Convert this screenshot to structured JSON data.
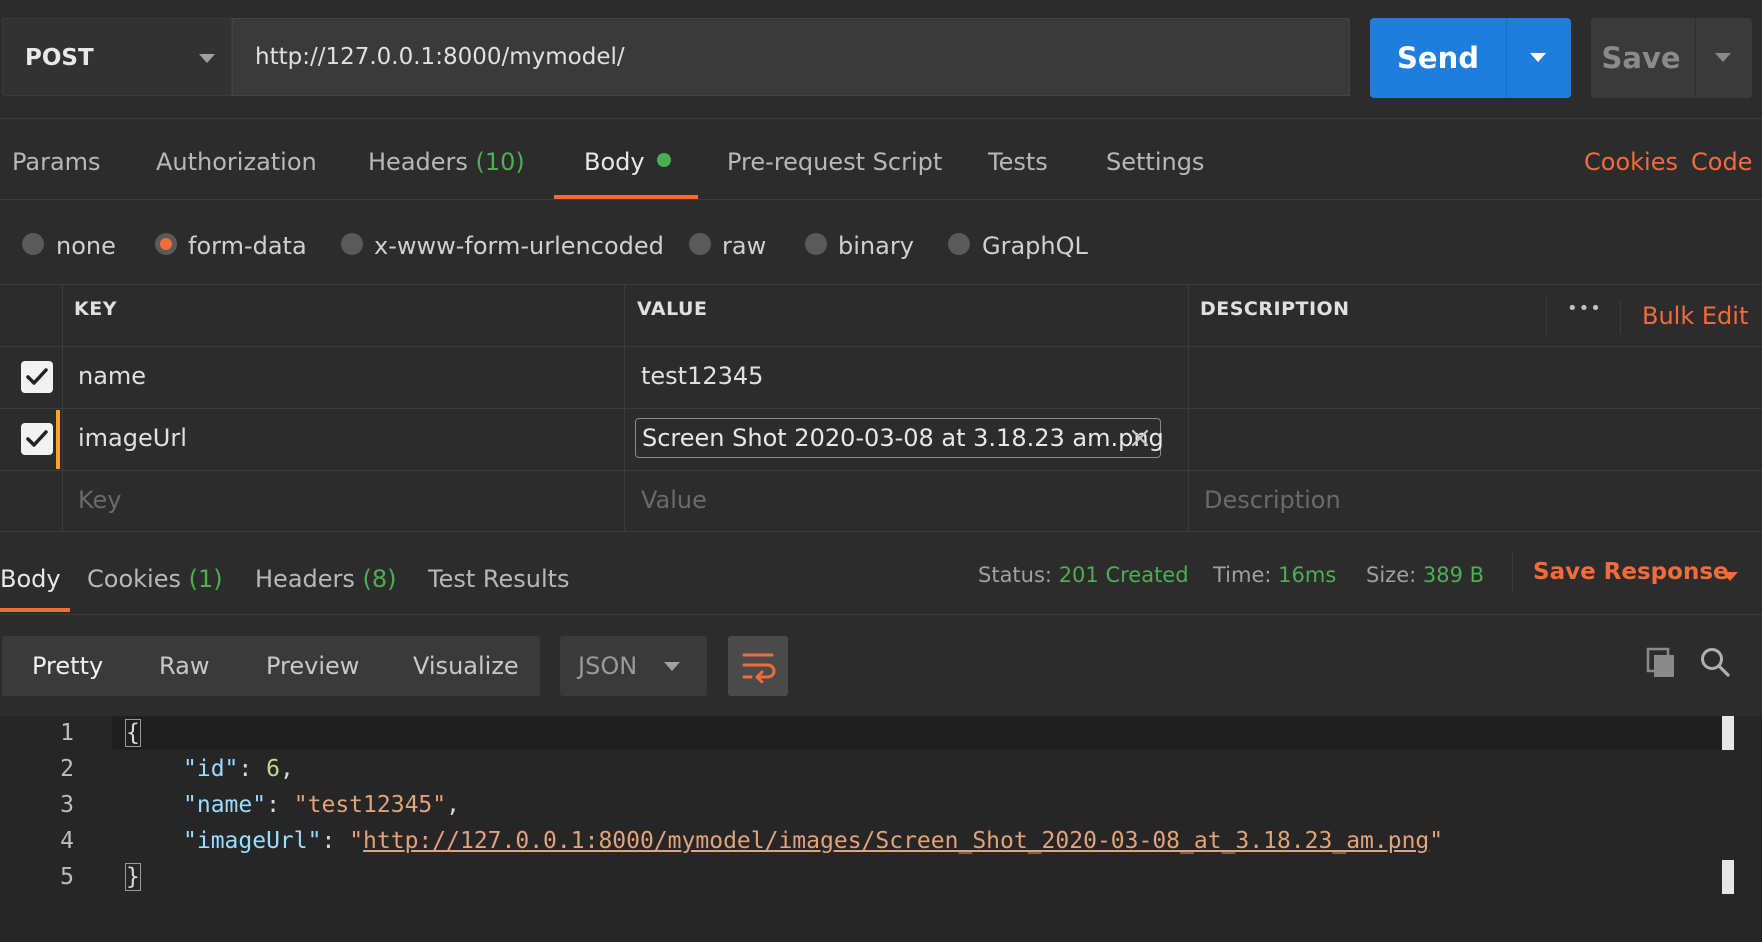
{
  "request": {
    "method": "POST",
    "url": "http://127.0.0.1:8000/mymodel/",
    "send_label": "Send",
    "save_label": "Save"
  },
  "request_tabs": {
    "params": "Params",
    "authorization": "Authorization",
    "headers": "Headers",
    "headers_count": "(10)",
    "body": "Body",
    "pre_request": "Pre-request Script",
    "tests": "Tests",
    "settings": "Settings",
    "cookies_link": "Cookies",
    "code_link": "Code"
  },
  "body_types": {
    "none": "none",
    "form_data": "form-data",
    "urlencoded": "x-www-form-urlencoded",
    "raw": "raw",
    "binary": "binary",
    "graphql": "GraphQL",
    "selected": "form-data"
  },
  "form_table": {
    "headers": {
      "key": "KEY",
      "value": "VALUE",
      "description": "DESCRIPTION"
    },
    "more_label": "•••",
    "bulk_edit": "Bulk Edit",
    "rows": [
      {
        "checked": true,
        "key": "name",
        "value": "test12345",
        "description": ""
      },
      {
        "checked": true,
        "key": "imageUrl",
        "value": "Screen Shot 2020-03-08 at 3.18.23 am.png",
        "description": ""
      }
    ],
    "placeholders": {
      "key": "Key",
      "value": "Value",
      "description": "Description"
    }
  },
  "response_tabs": {
    "body": "Body",
    "cookies": "Cookies",
    "cookies_count": "(1)",
    "headers": "Headers",
    "headers_count": "(8)",
    "test_results": "Test Results"
  },
  "response_status": {
    "status_label": "Status:",
    "status_value": "201 Created",
    "time_label": "Time:",
    "time_value": "16ms",
    "size_label": "Size:",
    "size_value": "389 B",
    "save_response": "Save Response"
  },
  "view_modes": {
    "pretty": "Pretty",
    "raw": "Raw",
    "preview": "Preview",
    "visualize": "Visualize",
    "format": "JSON"
  },
  "response_body": {
    "line_numbers": [
      "1",
      "2",
      "3",
      "4",
      "5"
    ],
    "open_brace": "{",
    "close_brace": "}",
    "id_key": "\"id\"",
    "id_value": "6",
    "name_key": "\"name\"",
    "name_value": "\"test12345\"",
    "image_key": "\"imageUrl\"",
    "image_value": "http://127.0.0.1:8000/mymodel/images/Screen_Shot_2020-03-08_at_3.18.23_am.png"
  },
  "colors": {
    "accent": "#f26b3a",
    "send_blue": "#1f7ddc",
    "success_green": "#4caf50",
    "background": "#2c2c2c"
  }
}
